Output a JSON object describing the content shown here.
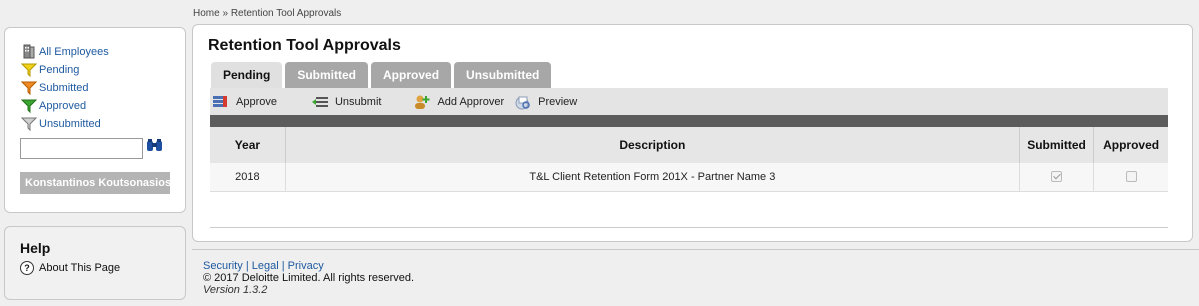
{
  "breadcrumb": {
    "home": "Home",
    "separator": "»",
    "current": "Retention Tool Approvals"
  },
  "sidebar": {
    "items": [
      {
        "label": "All Employees",
        "icon": "employees-icon"
      },
      {
        "label": "Pending",
        "icon": "filter-yellow-icon"
      },
      {
        "label": "Submitted",
        "icon": "filter-orange-icon"
      },
      {
        "label": "Approved",
        "icon": "filter-green-icon"
      },
      {
        "label": "Unsubmitted",
        "icon": "filter-gray-icon"
      }
    ],
    "search": {
      "value": "",
      "placeholder": ""
    },
    "user_name": "Konstantinos Koutsonasios"
  },
  "help": {
    "title": "Help",
    "about": "About This Page"
  },
  "main": {
    "title": "Retention Tool Approvals",
    "tabs": [
      {
        "label": "Pending",
        "active": true
      },
      {
        "label": "Submitted",
        "active": false
      },
      {
        "label": "Approved",
        "active": false
      },
      {
        "label": "Unsubmitted",
        "active": false
      }
    ],
    "toolbar": {
      "approve": "Approve",
      "unsubmit": "Unsubmit",
      "add_approver": "Add Approver",
      "preview": "Preview"
    },
    "table": {
      "headers": [
        "Year",
        "Description",
        "Submitted",
        "Approved"
      ],
      "rows": [
        {
          "year": "2018",
          "description": "T&L Client Retention Form 201X - Partner Name 3",
          "submitted": true,
          "approved": false
        }
      ]
    }
  },
  "footer": {
    "links": [
      "Security",
      "Legal",
      "Privacy"
    ],
    "separator": "|",
    "copyright": "© 2017 Deloitte Limited. All rights reserved.",
    "version": "Version 1.3.2"
  },
  "colors": {
    "link": "#1f5aa0",
    "tab_inactive": "#a7a7a7",
    "toolbar": "#e4e4e4",
    "darkbar": "#5c5c5c"
  }
}
